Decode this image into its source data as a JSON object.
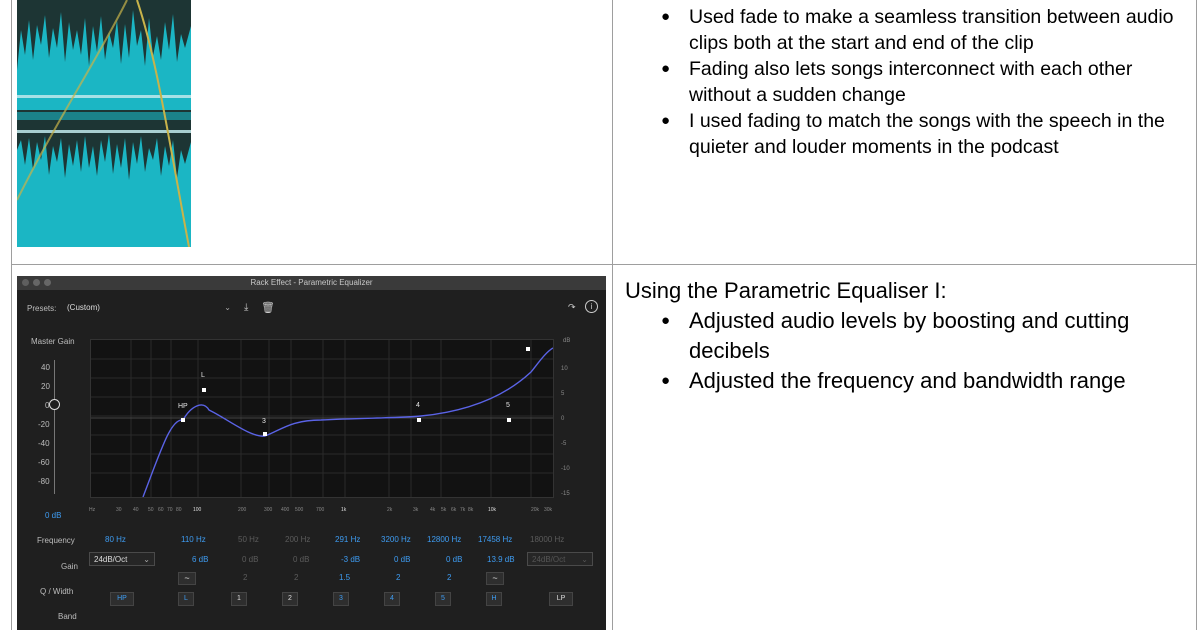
{
  "top_right": {
    "bullets": [
      "Used fade to make a seamless transition between audio clips both at the start and end of the clip",
      "Fading also lets songs interconnect with each other without a sudden change",
      "I used fading to match the songs with the speech in the quieter and louder moments in the podcast"
    ]
  },
  "bottom_right": {
    "intro": "Using the Parametric Equaliser I:",
    "bullets": [
      "Adjusted audio levels by boosting and cutting decibels",
      "Adjusted the frequency and bandwidth range"
    ]
  },
  "equalizer": {
    "title": "Rack Effect - Parametric Equalizer",
    "presets_label": "Presets:",
    "preset_value": "(Custom)",
    "master_gain_label": "Master Gain",
    "master_gain_value": "0 dB",
    "db_label": "dB",
    "gain_ticks": [
      "40",
      "20",
      "0",
      "-20",
      "-40",
      "-60",
      "-80"
    ],
    "db_ticks": [
      "10",
      "5",
      "0",
      "-5",
      "-10",
      "-15"
    ],
    "freq_ticks": [
      "Hz",
      "30",
      "40",
      "50",
      "60",
      "70",
      "80",
      "100",
      "200",
      "300",
      "400",
      "500",
      "700",
      "1k",
      "2k",
      "3k",
      "4k",
      "5k",
      "6k",
      "7k",
      "8k",
      "10k",
      "20k",
      "30k"
    ],
    "row_labels": {
      "frequency": "Frequency",
      "gain": "Gain",
      "q_width": "Q / Width",
      "band": "Band"
    },
    "hp_slope": "24dB/Oct",
    "lp_slope": "24dB/Oct",
    "bands": [
      {
        "name": "HP",
        "freq": "80 Hz",
        "gain": "",
        "q": "",
        "active": true
      },
      {
        "name": "L",
        "freq": "110 Hz",
        "gain": "6 dB",
        "q": "~",
        "active": true
      },
      {
        "name": "1",
        "freq": "50 Hz",
        "gain": "0 dB",
        "q": "2",
        "active": false
      },
      {
        "name": "2",
        "freq": "200 Hz",
        "gain": "0 dB",
        "q": "2",
        "active": false
      },
      {
        "name": "3",
        "freq": "291 Hz",
        "gain": "-3 dB",
        "q": "1.5",
        "active": true
      },
      {
        "name": "4",
        "freq": "3200 Hz",
        "gain": "0 dB",
        "q": "2",
        "active": true
      },
      {
        "name": "5",
        "freq": "12800 Hz",
        "gain": "0 dB",
        "q": "2",
        "active": true
      },
      {
        "name": "H",
        "freq": "17458 Hz",
        "gain": "13.9 dB",
        "q": "~",
        "active": true
      },
      {
        "name": "LP",
        "freq": "18000 Hz",
        "gain": "",
        "q": "",
        "active": false
      }
    ],
    "curve_point_labels": [
      "HP",
      "L",
      "3",
      "4",
      "5"
    ]
  }
}
